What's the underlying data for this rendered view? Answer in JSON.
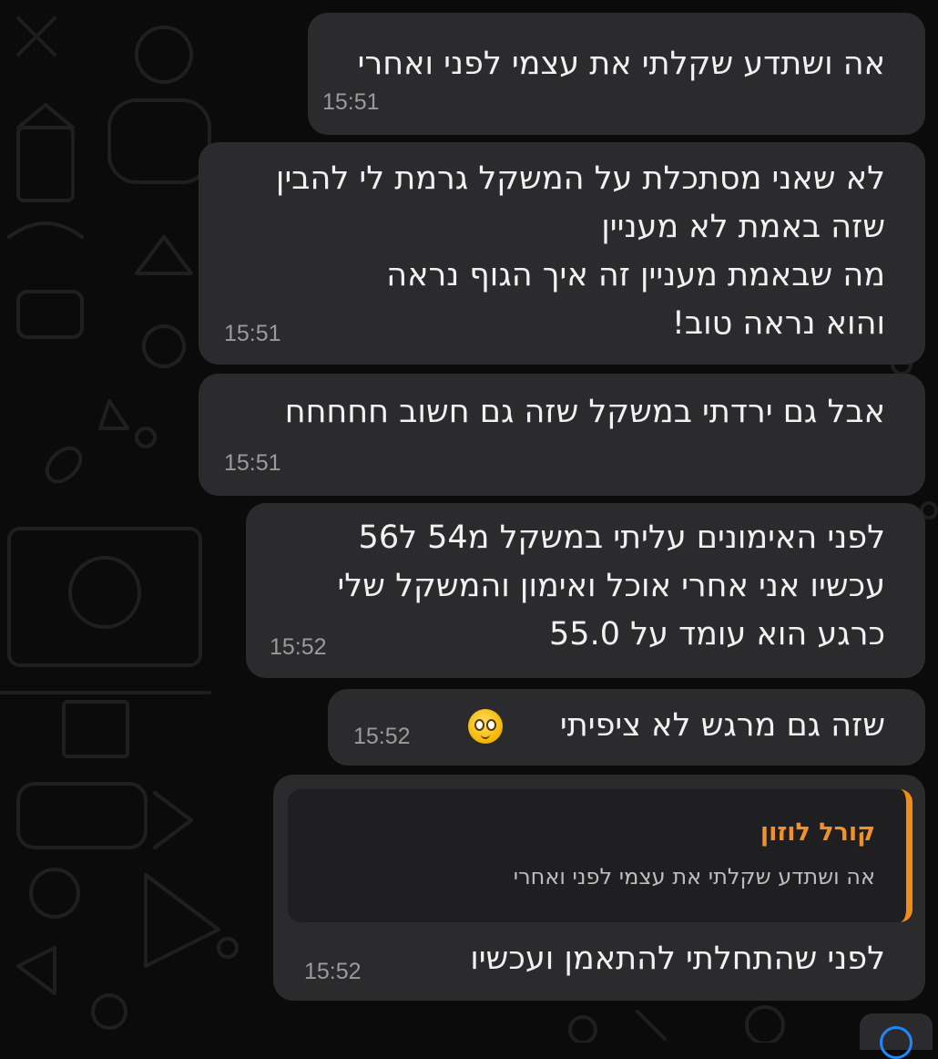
{
  "messages": [
    {
      "text": "אה ושתדע שקלתי את עצמי לפני ואחרי",
      "time": "15:51"
    },
    {
      "text": "לא שאני מסתכלת על המשקל גרמת לי להבין\nשזה באמת לא מעניין\nמה שבאמת מעניין זה איך הגוף נראה\nוהוא נראה טוב!",
      "time": "15:51"
    },
    {
      "text": "אבל גם ירדתי במשקל שזה גם חשוב חחחחח",
      "time": "15:51"
    },
    {
      "text": "לפני האימונים עליתי במשקל מ54 ל56\nעכשיו אני אחרי אוכל ואימון והמשקל שלי\nכרגע הוא עומד על 55.0",
      "time": "15:52"
    },
    {
      "text": "שזה גם מרגש לא ציפיתי",
      "time": "15:52",
      "emoji": "pleading-face-icon"
    },
    {
      "text": "לפני שהתחלתי להתאמן ועכשיו",
      "time": "15:52",
      "reply": {
        "author": "קורל לוזון",
        "text": "אה ושתדע שקלתי את עצמי לפני ואחרי"
      }
    }
  ],
  "colors": {
    "background": "#0b0b0b",
    "bubble": "#2b2b2d",
    "reply_accent": "#f08c19",
    "time": "#9a9a9a"
  }
}
